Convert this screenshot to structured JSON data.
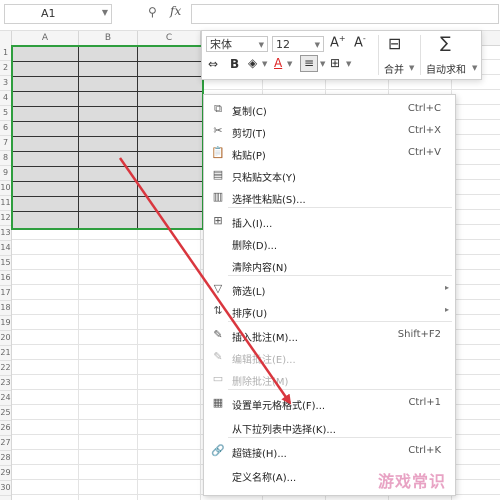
{
  "formula_bar": {
    "cell_reference": "A1",
    "fx_label": "fx",
    "formula_value": ""
  },
  "columns": [
    "A",
    "B",
    "C"
  ],
  "rows": [
    "1",
    "2",
    "3",
    "4",
    "5",
    "6",
    "7",
    "8",
    "9",
    "10",
    "11",
    "12",
    "13",
    "14",
    "15",
    "16",
    "17",
    "18",
    "19",
    "20",
    "21",
    "22",
    "23",
    "24",
    "25",
    "26",
    "27",
    "28",
    "29",
    "30"
  ],
  "mini_toolbar": {
    "font_name": "宋体",
    "font_size": "12",
    "increase_font_icon": "A+",
    "decrease_font_icon": "A-",
    "merge_label": "合并",
    "autosum_label": "自动求和",
    "bold_label": "B",
    "font_color_label": "A"
  },
  "context_menu": {
    "items": [
      {
        "label": "复制(C)",
        "shortcut": "Ctrl+C",
        "icon": "copy-icon",
        "disabled": false
      },
      {
        "label": "剪切(T)",
        "shortcut": "Ctrl+X",
        "icon": "cut-icon",
        "disabled": false
      },
      {
        "label": "粘贴(P)",
        "shortcut": "Ctrl+V",
        "icon": "paste-icon",
        "disabled": false
      },
      {
        "label": "只粘贴文本(Y)",
        "shortcut": "",
        "icon": "paste-text-icon",
        "disabled": false
      },
      {
        "label": "选择性粘贴(S)...",
        "shortcut": "",
        "icon": "paste-special-icon",
        "disabled": false
      },
      {
        "label": "插入(I)...",
        "shortcut": "",
        "icon": "insert-icon",
        "disabled": false
      },
      {
        "label": "删除(D)...",
        "shortcut": "",
        "icon": "",
        "disabled": false
      },
      {
        "label": "清除内容(N)",
        "shortcut": "",
        "icon": "",
        "disabled": false
      },
      {
        "label": "筛选(L)",
        "shortcut": "",
        "icon": "filter-icon",
        "disabled": false
      },
      {
        "label": "排序(U)",
        "shortcut": "",
        "icon": "sort-icon",
        "disabled": false
      },
      {
        "label": "插入批注(M)...",
        "shortcut": "Shift+F2",
        "icon": "comment-icon",
        "disabled": false
      },
      {
        "label": "编辑批注(E)...",
        "shortcut": "",
        "icon": "edit-comment-icon",
        "disabled": true
      },
      {
        "label": "删除批注(M)",
        "shortcut": "",
        "icon": "delete-comment-icon",
        "disabled": true
      },
      {
        "label": "设置单元格格式(F)...",
        "shortcut": "Ctrl+1",
        "icon": "format-cells-icon",
        "disabled": false
      },
      {
        "label": "从下拉列表中选择(K)...",
        "shortcut": "",
        "icon": "",
        "disabled": false
      },
      {
        "label": "超链接(H)...",
        "shortcut": "Ctrl+K",
        "icon": "link-icon",
        "disabled": false
      },
      {
        "label": "定义名称(A)...",
        "shortcut": "",
        "icon": "",
        "disabled": false
      }
    ]
  },
  "watermark": "游戏常识",
  "colors": {
    "selection_border": "#2e9e3e",
    "selection_fill": "#dcdcdc",
    "arrow": "#d9363e"
  }
}
